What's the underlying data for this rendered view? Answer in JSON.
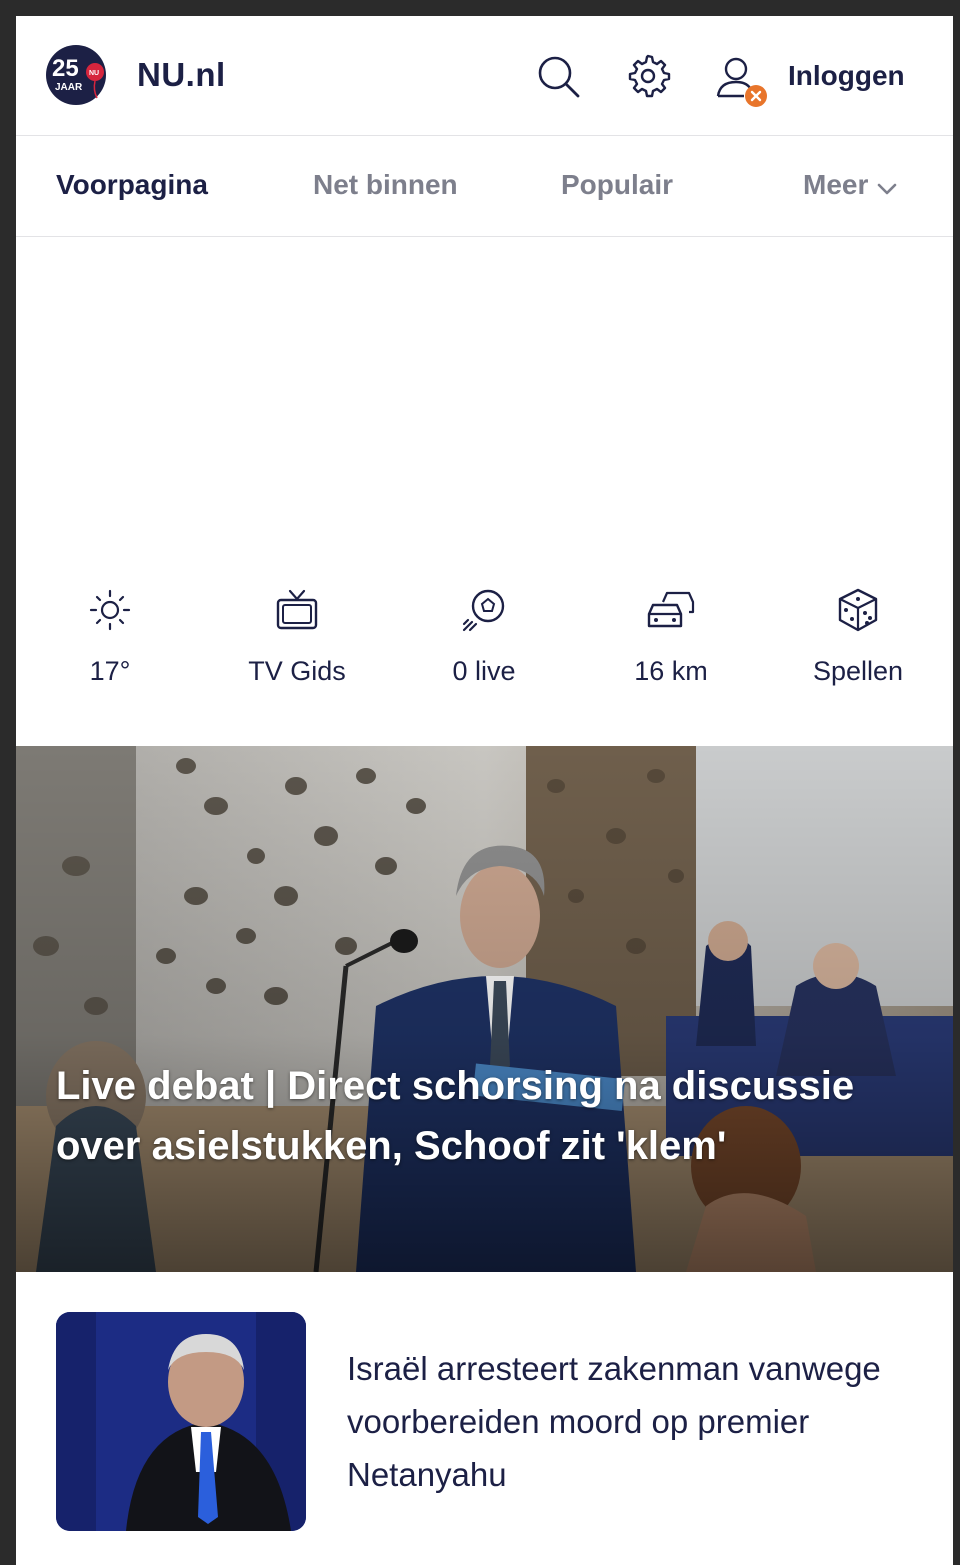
{
  "header": {
    "logo": {
      "number": "25",
      "sub": "JAAR",
      "tag": "NU"
    },
    "site_name": "NU.nl",
    "login_label": "Inloggen"
  },
  "nav": {
    "items": [
      {
        "label": "Voorpagina",
        "active": true
      },
      {
        "label": "Net binnen",
        "active": false
      },
      {
        "label": "Populair",
        "active": false
      },
      {
        "label": "Meer",
        "active": false
      }
    ]
  },
  "quick_links": [
    {
      "icon": "sun-icon",
      "label": "17°"
    },
    {
      "icon": "tv-icon",
      "label": "TV Gids"
    },
    {
      "icon": "football-icon",
      "label": "0 live"
    },
    {
      "icon": "traffic-icon",
      "label": "16 km"
    },
    {
      "icon": "dice-icon",
      "label": "Spellen"
    }
  ],
  "hero": {
    "title": "Live debat | Direct schorsing na discussie over asielstukken, Schoof zit 'klem'"
  },
  "articles": [
    {
      "title": "Israël arresteert zakenman vanwege voorbereiden moord op premier Netanyahu"
    }
  ],
  "colors": {
    "navy": "#1c2045",
    "muted": "#7d7f8c",
    "badge_orange": "#e8752b",
    "logo_red": "#d6253d"
  }
}
